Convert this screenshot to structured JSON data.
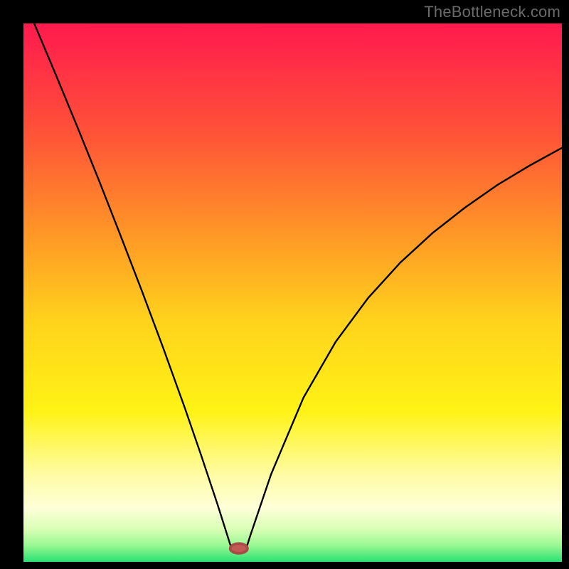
{
  "watermark": "TheBottleneck.com",
  "chart_data": {
    "type": "line",
    "title": "",
    "xlabel": "",
    "ylabel": "",
    "xlim": [
      0,
      100
    ],
    "ylim": [
      0,
      100
    ],
    "grid": false,
    "legend": false,
    "background_gradient": {
      "stops": [
        {
          "offset": 0.0,
          "color": "#ff1a4e"
        },
        {
          "offset": 0.2,
          "color": "#ff5138"
        },
        {
          "offset": 0.4,
          "color": "#ff9a26"
        },
        {
          "offset": 0.55,
          "color": "#ffd21c"
        },
        {
          "offset": 0.72,
          "color": "#fff315"
        },
        {
          "offset": 0.84,
          "color": "#fffca7"
        },
        {
          "offset": 0.9,
          "color": "#feffd8"
        },
        {
          "offset": 0.94,
          "color": "#d8ffb5"
        },
        {
          "offset": 0.97,
          "color": "#97f891"
        },
        {
          "offset": 1.0,
          "color": "#29e072"
        }
      ]
    },
    "series": [
      {
        "name": "bottleneck-curve",
        "x": [
          2,
          6,
          10,
          14,
          18,
          22,
          26,
          30,
          33,
          36,
          37.9,
          38.5,
          38.5,
          41.5,
          41.5,
          42.1,
          46,
          52,
          58,
          64,
          70,
          76,
          82,
          88,
          94,
          100
        ],
        "y": [
          100,
          90.5,
          80.8,
          70.9,
          60.7,
          50.3,
          39.6,
          28.5,
          19.8,
          10.8,
          4.8,
          2.9,
          2.5,
          2.5,
          2.9,
          4.8,
          16.3,
          30.5,
          40.9,
          49.0,
          55.6,
          61.1,
          65.8,
          70.0,
          73.6,
          76.9
        ]
      }
    ],
    "marker": {
      "name": "optimal-point",
      "x": 40,
      "y": 2.5,
      "rx": 1.6,
      "ry": 0.9,
      "color": "#c15a55"
    }
  }
}
